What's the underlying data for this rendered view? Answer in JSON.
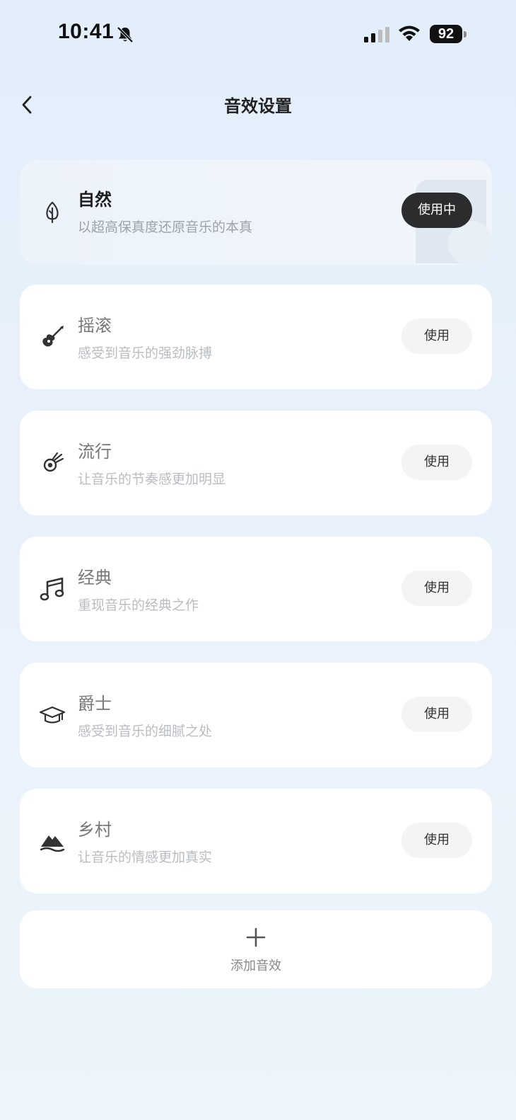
{
  "status_bar": {
    "time": "10:41",
    "battery": "92",
    "icons": [
      "bell-off-icon",
      "signal-icon",
      "wifi-icon",
      "battery-icon"
    ]
  },
  "header": {
    "title": "音效设置",
    "back_icon": "chevron-left-icon"
  },
  "presets": [
    {
      "title": "自然",
      "subtitle": "以超高保真度还原音乐的本真",
      "button": "使用中",
      "active": true,
      "icon": "leaf-icon"
    },
    {
      "title": "摇滚",
      "subtitle": "感受到音乐的强劲脉搏",
      "button": "使用",
      "active": false,
      "icon": "guitar-icon"
    },
    {
      "title": "流行",
      "subtitle": "让音乐的节奏感更加明显",
      "button": "使用",
      "active": false,
      "icon": "flame-icon"
    },
    {
      "title": "经典",
      "subtitle": "重现音乐的经典之作",
      "button": "使用",
      "active": false,
      "icon": "music-note-icon"
    },
    {
      "title": "爵士",
      "subtitle": "感受到音乐的细腻之处",
      "button": "使用",
      "active": false,
      "icon": "graduation-cap-icon"
    },
    {
      "title": "乡村",
      "subtitle": "让音乐的情感更加真实",
      "button": "使用",
      "active": false,
      "icon": "mountain-icon"
    }
  ],
  "add_button": {
    "label": "添加音效",
    "icon": "plus-icon"
  },
  "colors": {
    "background": "#e6f0fb",
    "active_button": "#2c2c2e",
    "inactive_button": "#f3f4f6"
  }
}
